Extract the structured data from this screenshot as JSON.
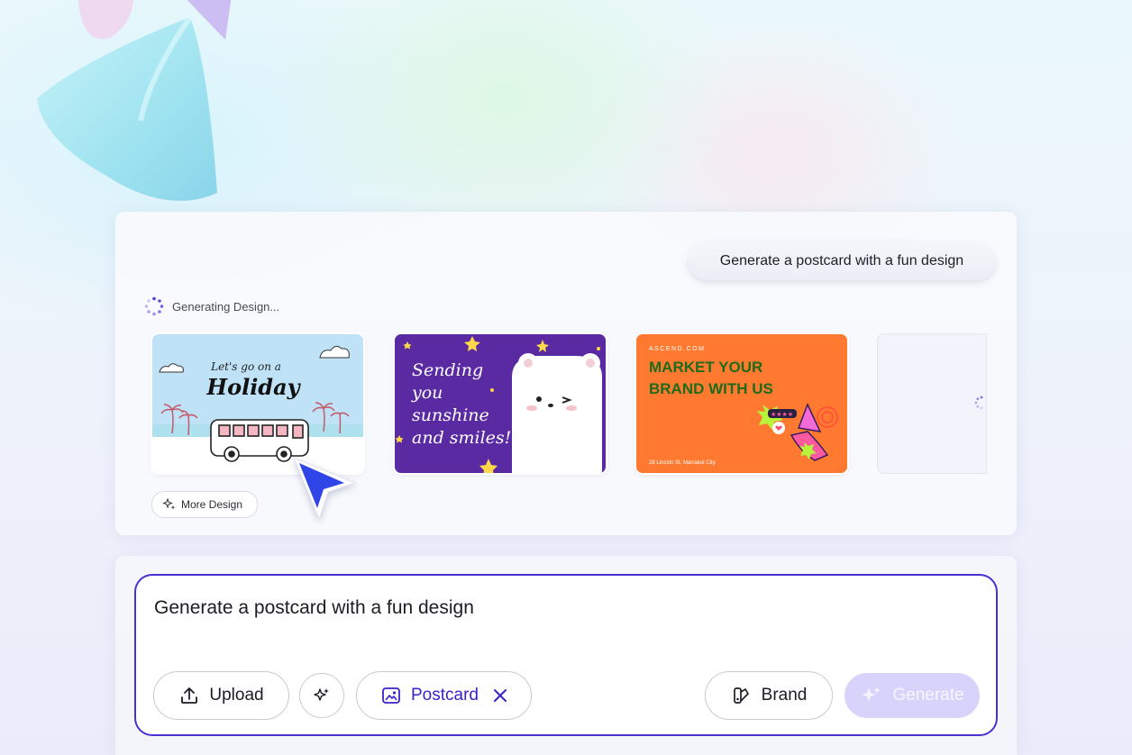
{
  "chat": {
    "prompt_bubble": "Generate a postcard with a fun design",
    "status_text": "Generating Design..."
  },
  "designs": [
    {
      "line1": "Let's go on a",
      "line2": "Holiday"
    },
    {
      "line1": "Sending",
      "line2": "you",
      "line3": "sunshine",
      "line4": "and smiles!"
    },
    {
      "brand": "ASCEND.COM",
      "line1": "MARKET YOUR",
      "line2": "BRAND WITH US",
      "address": "28 Lincoln St. Marrakot City"
    }
  ],
  "more_design_label": "More Design",
  "composer": {
    "input_value": "Generate a postcard with a fun design",
    "upload_label": "Upload",
    "postcard_chip_label": "Postcard",
    "brand_label": "Brand",
    "generate_label": "Generate"
  },
  "colors": {
    "accent": "#3a22c8",
    "generate_disabled_bg": "#d8d3fb",
    "card2_bg": "#5a2aa3",
    "card3_bg": "#ff7a30",
    "card3_text": "#1f6b1a"
  },
  "icons": {
    "upload": "upload-icon",
    "magic": "sparkle-icon",
    "postcard": "postcard-icon",
    "remove": "close-icon",
    "brand": "palette-icon",
    "generate": "sparkle-icon"
  }
}
